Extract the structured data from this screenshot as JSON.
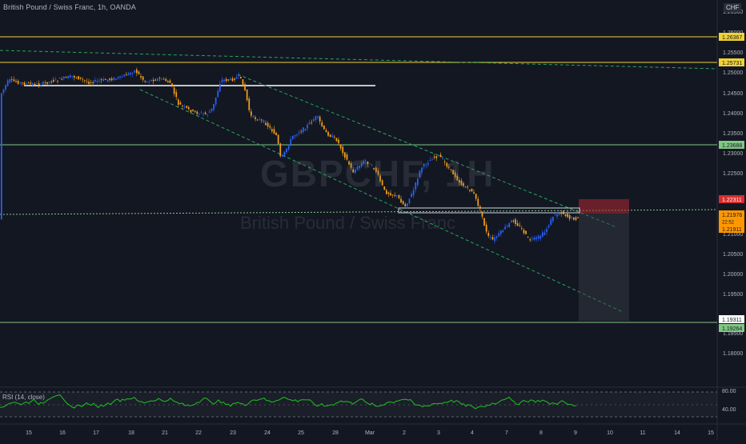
{
  "header": {
    "instrument": "British Pound / Swiss Franc, 1h, OANDA",
    "currency": "CHF"
  },
  "watermark": {
    "symbol": "GBPCHF, 1H",
    "name": "British Pound / Swiss Franc"
  },
  "rsi": {
    "label": "RSI (14, close)",
    "levels": [
      "80.00",
      "40.00"
    ]
  },
  "colors": {
    "background": "#131722",
    "bull": "#2962ff",
    "bear": "#f7a21b",
    "level_yellow": "#f0d236",
    "level_green": "#81c784",
    "trend_green": "#26a65b",
    "rsi_line": "#1fc21f",
    "stop_zone": "#b22833",
    "target_zone": "#3a3e48",
    "last_price": "#ff9800"
  },
  "price_axis": {
    "ticks": [
      "1.26500",
      "1.26000",
      "1.25500",
      "1.25000",
      "1.24500",
      "1.24000",
      "1.23500",
      "1.23000",
      "1.22500",
      "1.21500",
      "1.21000",
      "1.20500",
      "1.20000",
      "1.19500",
      "1.18500",
      "1.18000"
    ],
    "badges": [
      {
        "label": "1.26367",
        "style": "yellow"
      },
      {
        "label": "1.25731",
        "style": "yellow"
      },
      {
        "label": "1.23688",
        "style": "green"
      },
      {
        "label": "1.22311",
        "style": "red"
      },
      {
        "label": "1.21976",
        "style": "orange"
      },
      {
        "label": "22:52",
        "style": "orange-small"
      },
      {
        "label": "1.21911",
        "style": "orange"
      },
      {
        "label": "1.19311",
        "style": "white"
      },
      {
        "label": "1.19264",
        "style": "green"
      }
    ]
  },
  "time_axis": {
    "labels": [
      "15",
      "16",
      "17",
      "18",
      "21",
      "22",
      "23",
      "24",
      "25",
      "28",
      "Mar",
      "2",
      "3",
      "4",
      "7",
      "8",
      "9",
      "10",
      "11",
      "14",
      "15"
    ]
  },
  "levels": [
    "1.26367",
    "1.25731",
    "1.23688",
    "1.22311",
    "1.21976",
    "1.19264"
  ]
}
